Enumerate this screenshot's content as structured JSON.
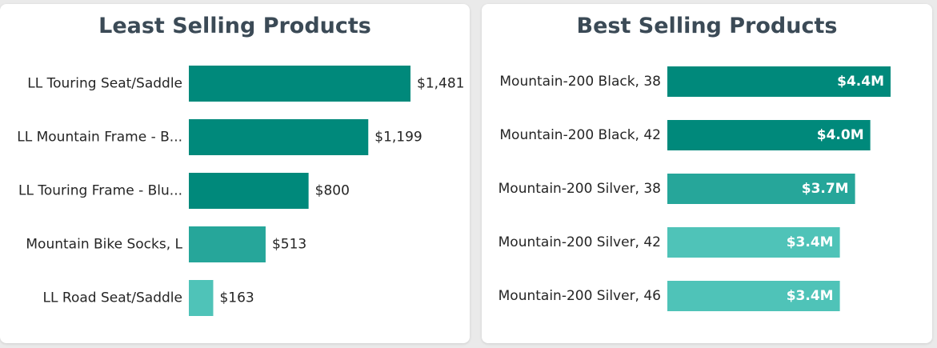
{
  "chart_data": [
    {
      "type": "bar",
      "orientation": "horizontal",
      "title": "Least Selling Products",
      "categories": [
        "LL Touring Seat/Saddle",
        "LL Mountain Frame - B...",
        "LL Touring Frame - Blu...",
        "Mountain Bike Socks, L",
        "LL Road Seat/Saddle"
      ],
      "values": [
        1481,
        1199,
        800,
        513,
        163
      ],
      "value_labels": [
        "$1,481",
        "$1,199",
        "$800",
        "$513",
        "$163"
      ],
      "colors": [
        "#00897b",
        "#00897b",
        "#00897b",
        "#26a69a",
        "#4fc3b8"
      ],
      "label_position": "outside",
      "xlim": [
        0,
        1481
      ]
    },
    {
      "type": "bar",
      "orientation": "horizontal",
      "title": "Best Selling Products",
      "categories": [
        "Mountain-200 Black, 38",
        "Mountain-200 Black, 42",
        "Mountain-200 Silver, 38",
        "Mountain-200 Silver, 42",
        "Mountain-200 Silver, 46"
      ],
      "values": [
        4.4,
        4.0,
        3.7,
        3.4,
        3.4
      ],
      "value_labels": [
        "$4.4M",
        "$4.0M",
        "$3.7M",
        "$3.4M",
        "$3.4M"
      ],
      "colors": [
        "#00897b",
        "#00897b",
        "#26a69a",
        "#4fc3b8",
        "#4fc3b8"
      ],
      "label_position": "inside-end",
      "xlim": [
        0,
        4.4
      ]
    }
  ]
}
